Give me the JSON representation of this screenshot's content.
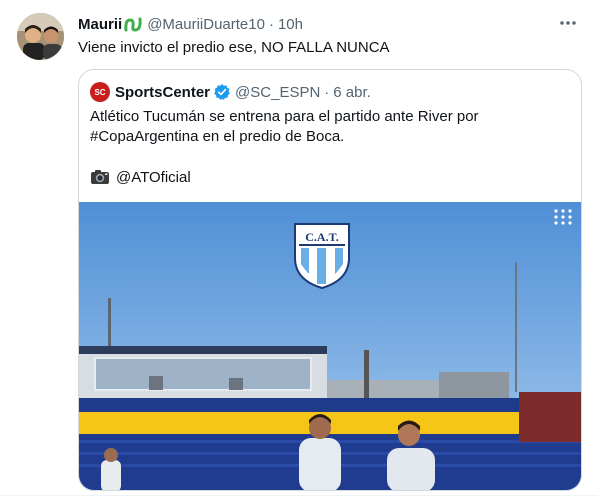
{
  "tweet": {
    "display_name": "Maurii",
    "name_emoji": "green-loop-emoji",
    "handle": "@MauriiDuarte10",
    "separator": "·",
    "time": "10h",
    "text": "Viene invicto el predio ese, NO FALLA NUNCA",
    "more_icon": "more-horizontal-icon"
  },
  "quote": {
    "avatar_text": "SC",
    "display_name": "SportsCenter",
    "verified_icon": "verified-badge-icon",
    "handle": "@SC_ESPN",
    "separator": "·",
    "time": "6 abr.",
    "text_line1": "Atlético Tucumán se entrena para el partido ante River por",
    "text_line2": "#CopaArgentina en el predio de Boca.",
    "credit_icon": "camera-icon",
    "credit": "@ATOficial",
    "media_crest_text": "C.A.T.",
    "media_grid_icon": "grid-dots-icon"
  },
  "colors": {
    "accent": "#1d9bf0",
    "text_primary": "#0f1419",
    "text_secondary": "#536471",
    "border": "#cfd9de",
    "stand_blue": "#1e3a8a",
    "stand_yellow": "#f5c518"
  }
}
